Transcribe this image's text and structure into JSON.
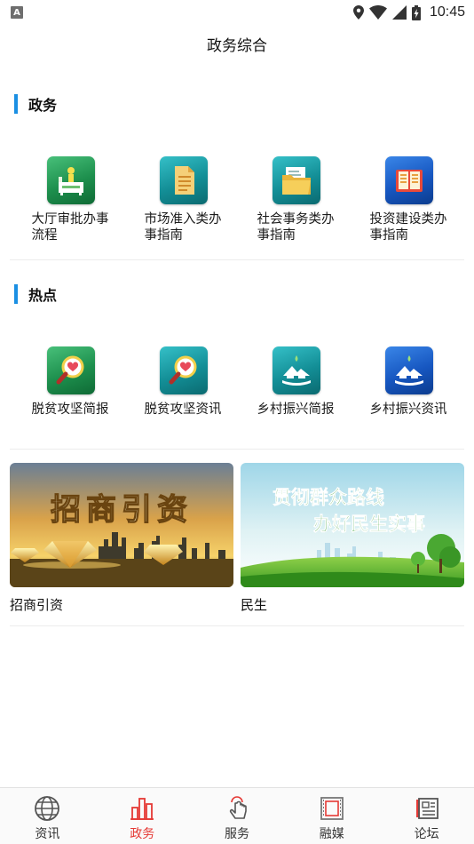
{
  "status_bar": {
    "notification_letter": "A",
    "time": "10:45",
    "icons": [
      "location-icon",
      "wifi-icon",
      "signal-icon",
      "battery-icon"
    ]
  },
  "header": {
    "title": "政务综合"
  },
  "sections": [
    {
      "title": "政务",
      "items": [
        {
          "label": "大厅审批办事流程",
          "icon": "approval-desk-icon",
          "color": "green"
        },
        {
          "label": "市场准入类办事指南",
          "icon": "document-icon",
          "color": "teal"
        },
        {
          "label": "社会事务类办事指南",
          "icon": "folder-icon",
          "color": "teal"
        },
        {
          "label": "投资建设类办事指南",
          "icon": "book-icon",
          "color": "blue"
        }
      ]
    },
    {
      "title": "热点",
      "items": [
        {
          "label": "脱贫攻坚简报",
          "icon": "magnifier-heart-icon",
          "color": "green"
        },
        {
          "label": "脱贫攻坚资讯",
          "icon": "magnifier-heart-icon",
          "color": "teal"
        },
        {
          "label": "乡村振兴简报",
          "icon": "village-icon",
          "color": "teal"
        },
        {
          "label": "乡村振兴资讯",
          "icon": "village-icon",
          "color": "blue"
        }
      ]
    }
  ],
  "banners": [
    {
      "image_text": "招商引资",
      "caption": "招商引资"
    },
    {
      "image_text_line1": "贯彻群众路线",
      "image_text_line2": "办好民生实事",
      "caption": "民生"
    }
  ],
  "bottom_nav": {
    "active_color": "#e53935",
    "items": [
      {
        "label": "资讯",
        "icon": "globe-icon",
        "active": false
      },
      {
        "label": "政务",
        "icon": "buildings-icon",
        "active": true
      },
      {
        "label": "服务",
        "icon": "touch-hand-icon",
        "active": false
      },
      {
        "label": "融媒",
        "icon": "film-icon",
        "active": false
      },
      {
        "label": "论坛",
        "icon": "newspaper-icon",
        "active": false
      }
    ]
  }
}
